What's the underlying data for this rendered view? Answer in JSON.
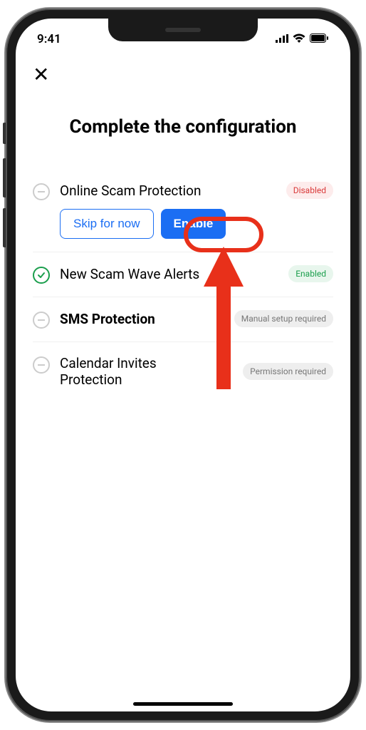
{
  "statusBar": {
    "time": "9:41"
  },
  "title": "Complete the configuration",
  "items": [
    {
      "label": "Online Scam Protection",
      "badge": "Disabled",
      "skipLabel": "Skip for now",
      "enableLabel": "Enable"
    },
    {
      "label": "New Scam Wave Alerts",
      "badge": "Enabled"
    },
    {
      "label": "SMS Protection",
      "badge": "Manual setup required"
    },
    {
      "label": "Calendar Invites Protection",
      "badge": "Permission required"
    }
  ]
}
